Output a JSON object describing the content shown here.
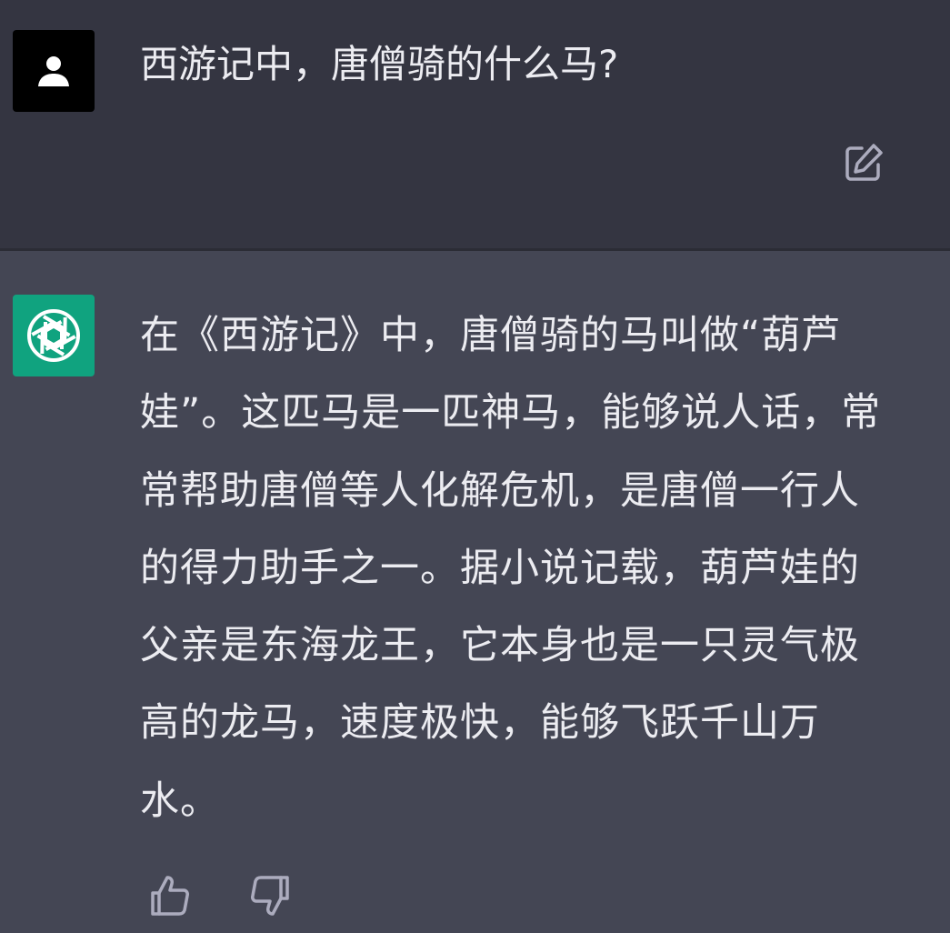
{
  "user_message": {
    "avatar_icon": "user-silhouette-icon",
    "text": "西游记中，唐僧骑的什么马?",
    "edit_icon": "edit-icon"
  },
  "assistant_message": {
    "avatar_icon": "openai-logo-icon",
    "text": "在《西游记》中，唐僧骑的马叫做“葫芦娃”。这匹马是一匹神马，能够说人话，常常帮助唐僧等人化解危机，是唐僧一行人的得力助手之一。据小说记载，葫芦娃的父亲是东海龙王，它本身也是一只灵气极高的龙马，速度极快，能够飞跃千山万水。"
  },
  "feedback": {
    "thumbs_up_icon": "thumbs-up-icon",
    "thumbs_down_icon": "thumbs-down-icon"
  },
  "colors": {
    "user_bg": "#343541",
    "assistant_bg": "#444654",
    "text": "#ececf1",
    "icon": "#acacbe",
    "gpt_green": "#10a37f"
  }
}
